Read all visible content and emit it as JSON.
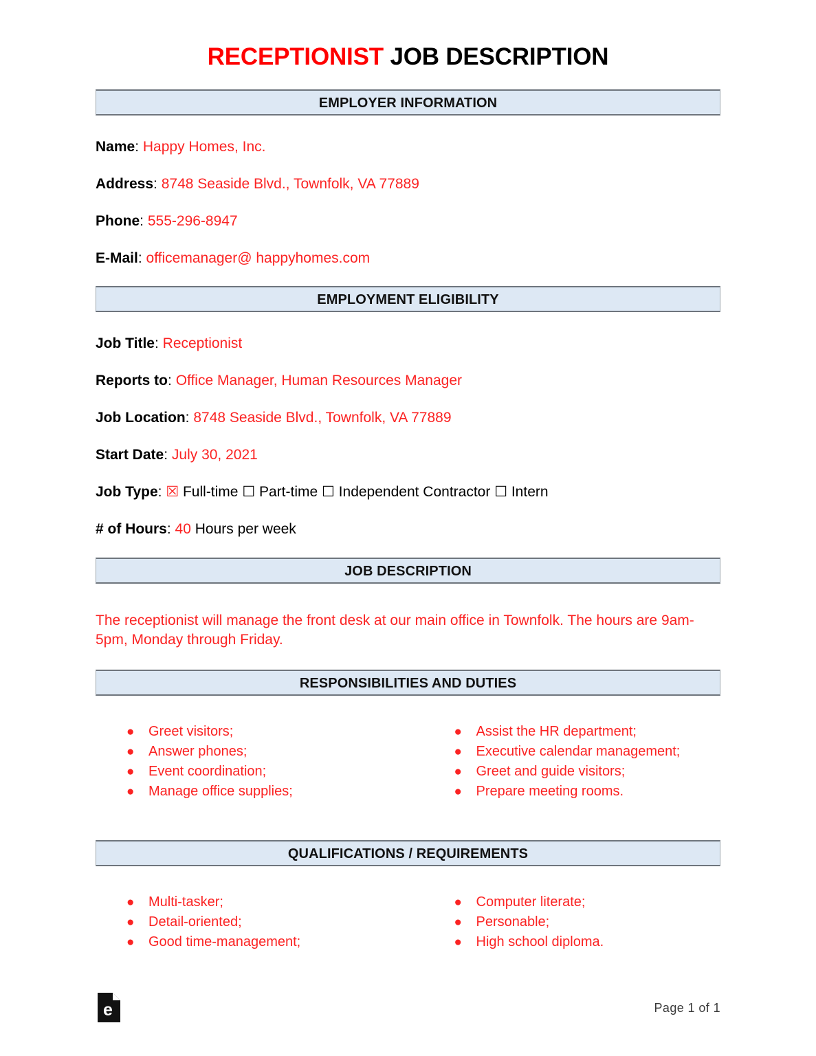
{
  "title": {
    "red_word": "RECEPTIONIST",
    "rest": " JOB DESCRIPTION"
  },
  "sections": {
    "employer_information": "EMPLOYER INFORMATION",
    "employment_eligibility": "EMPLOYMENT ELIGIBILITY",
    "job_description": "JOB DESCRIPTION",
    "responsibilities": "RESPONSIBILITIES AND DUTIES",
    "qualifications": "QUALIFICATIONS / REQUIREMENTS"
  },
  "employer": {
    "name_label": "Name",
    "name_value": "Happy Homes, Inc.",
    "address_label": "Address",
    "address_value": "8748 Seaside Blvd., Townfolk, VA 77889",
    "phone_label": "Phone",
    "phone_value": "555-296-8947",
    "email_label": "E-Mail",
    "email_value": "officemanager@ happyhomes.com"
  },
  "eligibility": {
    "job_title_label": "Job Title",
    "job_title_value": "Receptionist",
    "reports_to_label": "Reports to",
    "reports_to_value": "Office Manager, Human Resources Manager",
    "job_location_label": "Job Location",
    "job_location_value": "8748 Seaside Blvd., Townfolk, VA 77889",
    "start_date_label": "Start Date",
    "start_date_value": "July 30, 2021",
    "job_type_label": "Job Type",
    "job_type_options": [
      {
        "label": "Full-time",
        "checked": true,
        "glyph": "☒"
      },
      {
        "label": "Part-time",
        "checked": false,
        "glyph": "☐"
      },
      {
        "label": "Independent Contractor",
        "checked": false,
        "glyph": "☐"
      },
      {
        "label": "Intern",
        "checked": false,
        "glyph": "☐"
      }
    ],
    "hours_label": "# of Hours",
    "hours_value": "40",
    "hours_suffix": "Hours per week"
  },
  "description": {
    "text": "The receptionist will manage the front desk at our main office in Townfolk. The hours are 9am-5pm, Monday through Friday."
  },
  "responsibilities": {
    "left": [
      "Greet visitors;",
      "Answer phones;",
      "Event coordination;",
      "Manage office supplies;"
    ],
    "right": [
      "Assist the HR department;",
      "Executive calendar management;",
      "Greet and guide visitors;",
      "Prepare meeting rooms."
    ]
  },
  "qualifications": {
    "left": [
      "Multi-tasker;",
      "Detail-oriented;",
      "Good time-management;"
    ],
    "right": [
      "Computer literate;",
      "Personable;",
      "High school diploma."
    ]
  },
  "footer": {
    "logo_letter": "e",
    "page_number": "Page 1 of 1"
  },
  "colors": {
    "accent_red": "#fb2323",
    "title_red": "#ff0000",
    "bar_fill": "#dde8f4",
    "bar_border": "#6e757d"
  },
  "bullet_glyph": "●",
  "colon": ":"
}
